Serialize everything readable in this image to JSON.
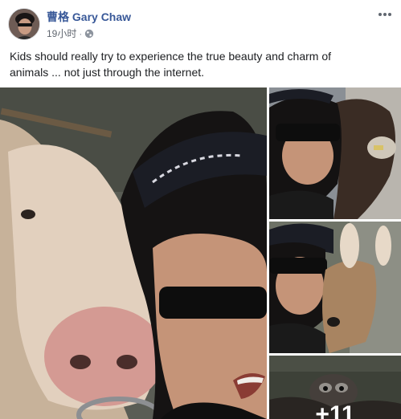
{
  "post": {
    "author": "曹格 Gary Chaw",
    "timestamp": "19小时",
    "separator": "·",
    "audience_icon": "globe-icon",
    "text": "Kids should really try to experience the true beauty and charm of\nanimals ... not just through the internet.",
    "more_icon": "more-horizontal-icon"
  },
  "gallery": {
    "more_count": "+11"
  },
  "colors": {
    "link": "#385898",
    "meta": "#616770",
    "text": "#1c1e21"
  }
}
